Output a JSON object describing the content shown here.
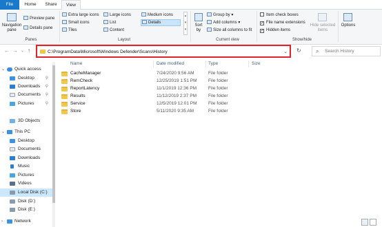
{
  "tabs": [
    "File",
    "Home",
    "Share",
    "View"
  ],
  "ribbon": {
    "panes": {
      "navigation_pane": "Navigation pane",
      "preview_pane": "Preview pane",
      "details_pane": "Details pane",
      "label": "Panes"
    },
    "layout": {
      "items": [
        "Extra large icons",
        "Large icons",
        "Medium icons",
        "Small icons",
        "List",
        "Details",
        "Tiles",
        "Content"
      ],
      "selected": "Details",
      "label": "Layout"
    },
    "current_view": {
      "sort_by": "Sort by",
      "group_by": "Group by",
      "add_columns": "Add columns",
      "size_all_columns": "Size all columns to fit",
      "label": "Current view"
    },
    "show_hide": {
      "item_check_boxes": {
        "label": "Item check boxes",
        "checked": false
      },
      "file_name_extensions": {
        "label": "File name extensions",
        "checked": true
      },
      "hidden_items": {
        "label": "Hidden items",
        "checked": true
      },
      "hide_selected_items": "Hide selected items",
      "label": "Show/hide"
    },
    "options": "Options"
  },
  "address": {
    "path": "C:\\ProgramData\\Microsoft\\Windows Defender\\Scans\\History"
  },
  "search": {
    "placeholder": "Search History"
  },
  "nav": {
    "items": [
      {
        "label": "Quick access",
        "pinned": false
      },
      {
        "label": "Desktop",
        "pinned": true
      },
      {
        "label": "Downloads",
        "pinned": true
      },
      {
        "label": "Documents",
        "pinned": true
      },
      {
        "label": "Pictures",
        "pinned": true
      },
      {
        "label": "3D Objects",
        "pinned": false
      },
      {
        "label": "This PC",
        "pinned": false
      },
      {
        "label": "Desktop",
        "pinned": false
      },
      {
        "label": "Documents",
        "pinned": false
      },
      {
        "label": "Downloads",
        "pinned": false
      },
      {
        "label": "Music",
        "pinned": false
      },
      {
        "label": "Pictures",
        "pinned": false
      },
      {
        "label": "Videos",
        "pinned": false
      },
      {
        "label": "Local Disk (C:)",
        "pinned": false,
        "selected": true
      },
      {
        "label": "Disk (D:)",
        "pinned": false
      },
      {
        "label": "Disk (E:)",
        "pinned": false
      },
      {
        "label": "Network",
        "pinned": false
      }
    ]
  },
  "columns": [
    "Name",
    "Date modified",
    "Type",
    "Size"
  ],
  "files": [
    {
      "name": "CacheManager",
      "date": "7/24/2020 9:56 AM",
      "type": "File folder"
    },
    {
      "name": "RemCheck",
      "date": "12/25/2019 1:51 PM",
      "type": "File folder"
    },
    {
      "name": "ReportLatency",
      "date": "11/1/2019 12:36 PM",
      "type": "File folder"
    },
    {
      "name": "Results",
      "date": "11/12/2019 2:37 PM",
      "type": "File folder"
    },
    {
      "name": "Service",
      "date": "12/5/2019 12:01 PM",
      "type": "File folder"
    },
    {
      "name": "Store",
      "date": "5/11/2020 9:35 AM",
      "type": "File folder"
    }
  ],
  "colors": {
    "file_tab": "#1979ca",
    "highlight_box": "#e0222a",
    "selection": "#cce8ff",
    "folder": "#f3c74e"
  }
}
